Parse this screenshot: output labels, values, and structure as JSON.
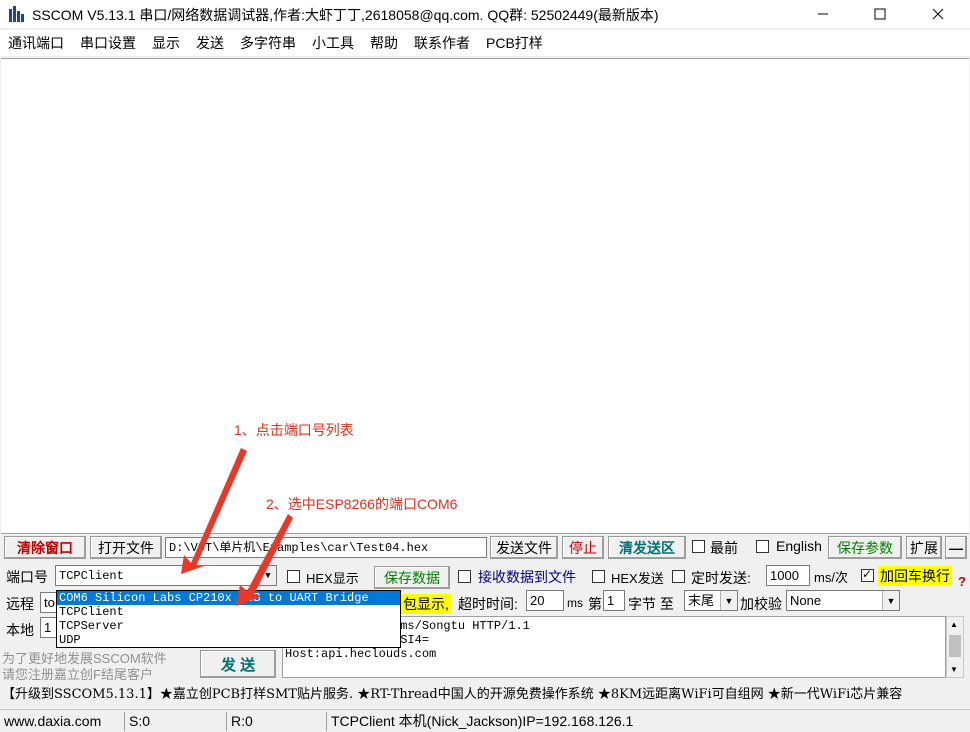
{
  "window": {
    "title": "SSCOM V5.13.1 串口/网络数据调试器,作者:大虾丁丁,2618058@qq.com. QQ群: 52502449(最新版本)"
  },
  "menu": [
    "通讯端口",
    "串口设置",
    "显示",
    "发送",
    "多字符串",
    "小工具",
    "帮助",
    "联系作者",
    "PCB打样"
  ],
  "toolbar": {
    "clear_window": "清除窗口",
    "open_file": "打开文件",
    "file_path": "D:\\VOT\\单片机\\Examples\\car\\Test04.hex",
    "send_file": "发送文件",
    "stop": "停止",
    "clear_send": "清发送区",
    "topmost": "最前",
    "english": "English",
    "save_params": "保存参数",
    "expand": "扩展",
    "minus": "—"
  },
  "row_port": {
    "port_label": "端口号",
    "port_value": "TCPClient",
    "hex_display": "HEX显示",
    "save_data": "保存数据",
    "recv_to_file": "接收数据到文件",
    "hex_send": "HEX发送",
    "timed_send": "定时发送:",
    "interval": "1000",
    "interval_unit": "ms/次",
    "add_crlf": "加回车换行",
    "help": "?"
  },
  "row_remote": {
    "remote_label": "远程",
    "remote_value": "to",
    "packet_display": "包显示,",
    "timeout_label": "超时时间:",
    "timeout_value": "20",
    "timeout_unit": "ms",
    "nth_label": "第",
    "nth_value": "1",
    "byte_label": "字节 至",
    "end_value": "末尾",
    "checksum_label": "加校验",
    "checksum_value": "None"
  },
  "row_local": {
    "local_label": "本地",
    "local_value": "1"
  },
  "port_list": [
    "COM6 Silicon Labs CP210x USB to UART Bridge",
    "TCPClient",
    "TCPServer",
    "UDP"
  ],
  "promo": {
    "line1": "为了更好地发展SSCOM软件",
    "line2": "请您注册嘉立创F结尾客户"
  },
  "send_button": "发 送",
  "send_text": "581212/datastreams/Songtu HTTP/1.1\nKw7YCcKrZ2CmlYlaSI4=\nHost:api.heclouds.com",
  "ticker": "【升级到SSCOM5.13.1】★嘉立创PCB打样SMT贴片服务. ★RT-Thread中国人的开源免费操作系统 ★8KM远距离WiFi可自组网 ★新一代WiFi芯片兼容",
  "status": {
    "website": "www.daxia.com",
    "sent": "S:0",
    "received": "R:0",
    "connection": "TCPClient 本机(Nick_Jackson)IP=192.168.126.1"
  },
  "annotations": {
    "step1": "1、点击端口号列表",
    "step2": "2、选中ESP8266的端口COM6"
  },
  "colors": {
    "annotation": "#e03020",
    "selection": "#0078d7",
    "highlight": "#ffff00"
  }
}
